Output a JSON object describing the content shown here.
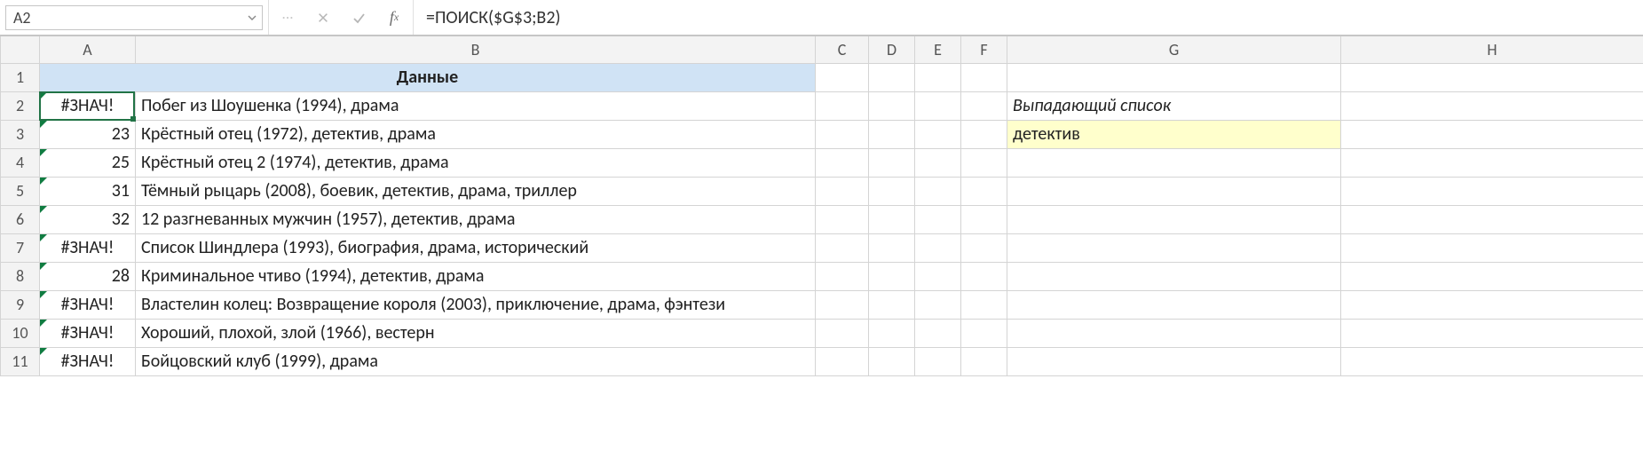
{
  "namebox": {
    "value": "A2"
  },
  "formula": {
    "value": "=ПОИСК($G$3;B2)"
  },
  "columns": [
    "A",
    "B",
    "C",
    "D",
    "E",
    "F",
    "G",
    "H"
  ],
  "header": {
    "merged_label": "Данные"
  },
  "dropdown": {
    "hint": "Выпадающий список",
    "value": "детектив"
  },
  "rows": [
    {
      "n": "2",
      "a": "#ЗНАЧ!",
      "a_type": "err",
      "b": "Побег из Шоушенка (1994), драма"
    },
    {
      "n": "3",
      "a": "23",
      "a_type": "num",
      "b": "Крёстный отец (1972), детектив, драма"
    },
    {
      "n": "4",
      "a": "25",
      "a_type": "num",
      "b": "Крёстный отец 2 (1974), детектив, драма"
    },
    {
      "n": "5",
      "a": "31",
      "a_type": "num",
      "b": "Тёмный рыцарь (2008), боевик, детектив, драма, триллер"
    },
    {
      "n": "6",
      "a": "32",
      "a_type": "num",
      "b": "12 разгневанных мужчин (1957), детектив, драма"
    },
    {
      "n": "7",
      "a": "#ЗНАЧ!",
      "a_type": "err",
      "b": "Список Шиндлера (1993), биография, драма, исторический"
    },
    {
      "n": "8",
      "a": "28",
      "a_type": "num",
      "b": "Криминальное чтиво (1994), детектив, драма"
    },
    {
      "n": "9",
      "a": "#ЗНАЧ!",
      "a_type": "err",
      "b": "Властелин колец: Возвращение короля (2003), приключение, драма, фэнтези"
    },
    {
      "n": "10",
      "a": "#ЗНАЧ!",
      "a_type": "err",
      "b": "Хороший, плохой, злой (1966), вестерн"
    },
    {
      "n": "11",
      "a": "#ЗНАЧ!",
      "a_type": "err",
      "b": "Бойцовский клуб (1999), драма"
    }
  ]
}
